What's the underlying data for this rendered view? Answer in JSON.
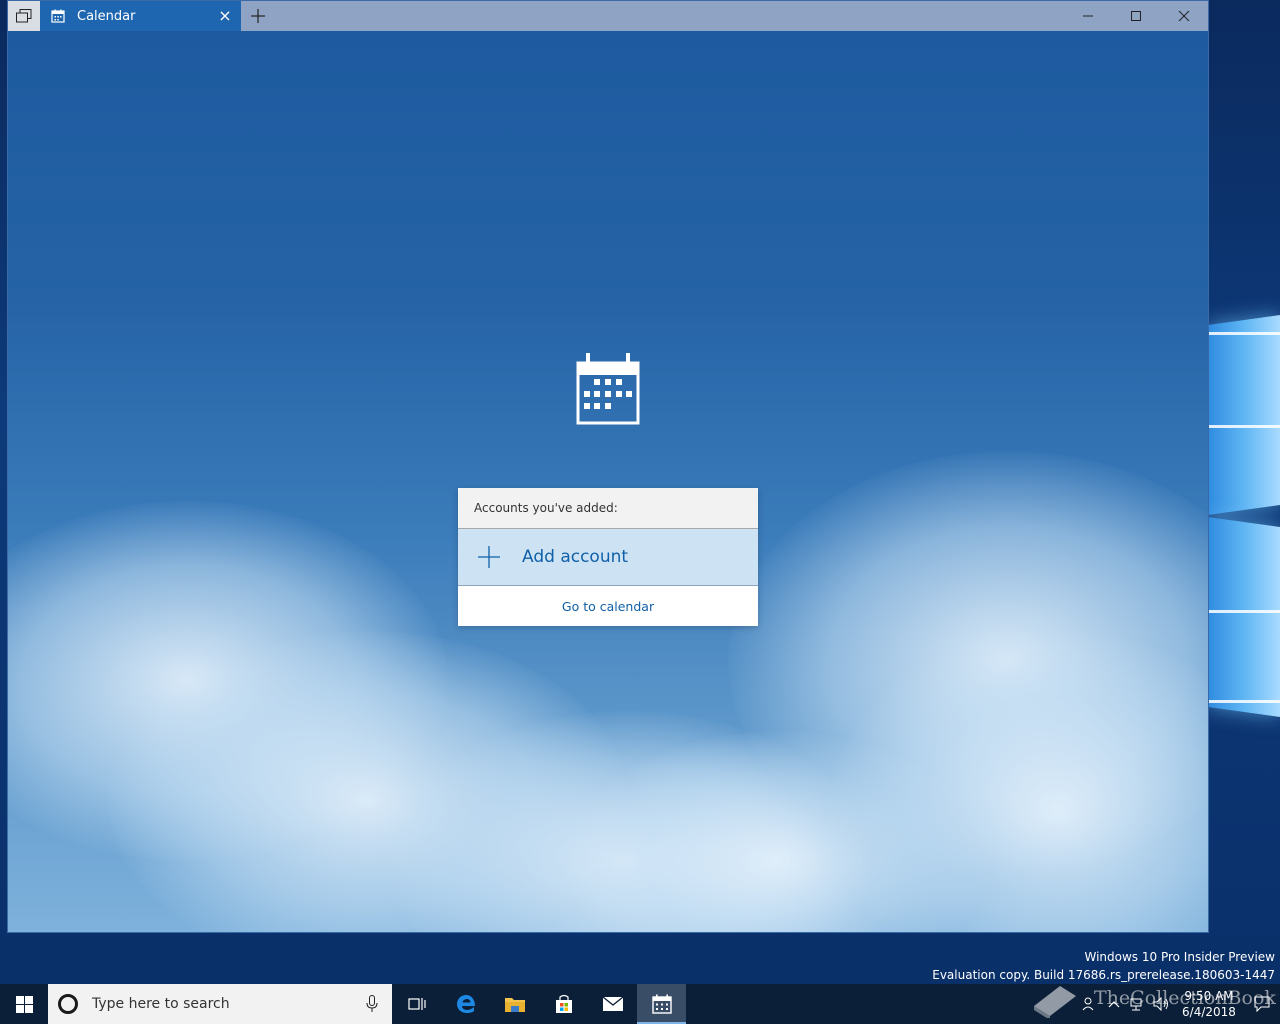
{
  "window": {
    "tab_title": "Calendar",
    "controls": {
      "minimize": "—",
      "maximize": "☐",
      "close": "✕"
    }
  },
  "panel": {
    "header": "Accounts you've added:",
    "add_account": "Add account",
    "go_to_calendar": "Go to calendar"
  },
  "watermark": {
    "line1": "Windows 10 Pro Insider Preview",
    "line2": "Evaluation copy. Build 17686.rs_prerelease.180603-1447"
  },
  "taskbar": {
    "search_placeholder": "Type here to search",
    "time": "9:50 AM",
    "date": "6/4/2018",
    "overlay_brand": "TheCollectionBook"
  },
  "colors": {
    "accent": "#1f66b0",
    "link": "#1060a8",
    "taskbar": "#0c1f38"
  }
}
